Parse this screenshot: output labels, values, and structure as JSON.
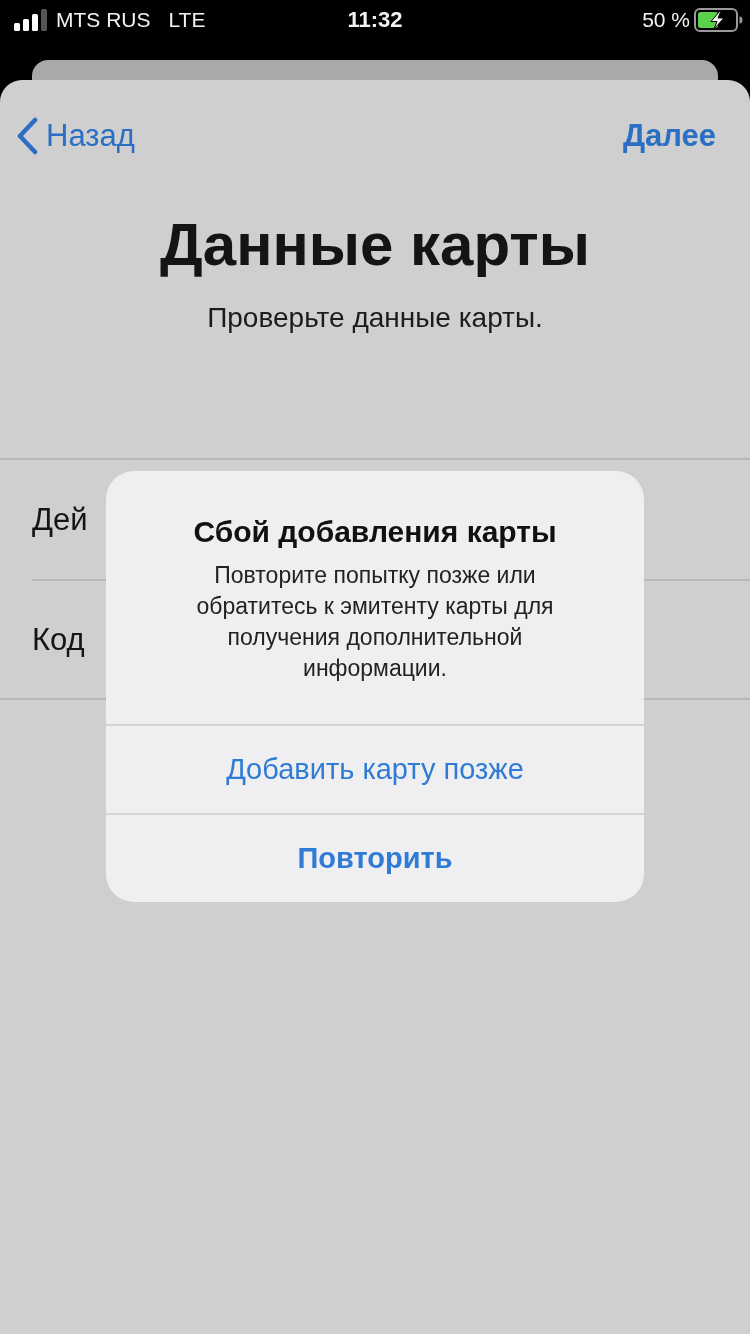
{
  "status_bar": {
    "carrier": "MTS RUS",
    "network": "LTE",
    "time": "11:32",
    "battery": "50 %"
  },
  "nav": {
    "back": "Назад",
    "next": "Далее"
  },
  "header": {
    "title": "Данные карты",
    "subtitle": "Проверьте данные карты."
  },
  "rows": [
    {
      "label": "Дей"
    },
    {
      "label": "Код"
    }
  ],
  "alert": {
    "title": "Сбой добавления карты",
    "message": "Повторите попытку позже или обратитесь к эмитенту карты для получения дополнительной информации.",
    "actions": [
      {
        "label": "Добавить карту позже",
        "kind": "normal"
      },
      {
        "label": "Повторить",
        "kind": "preferred"
      }
    ]
  }
}
